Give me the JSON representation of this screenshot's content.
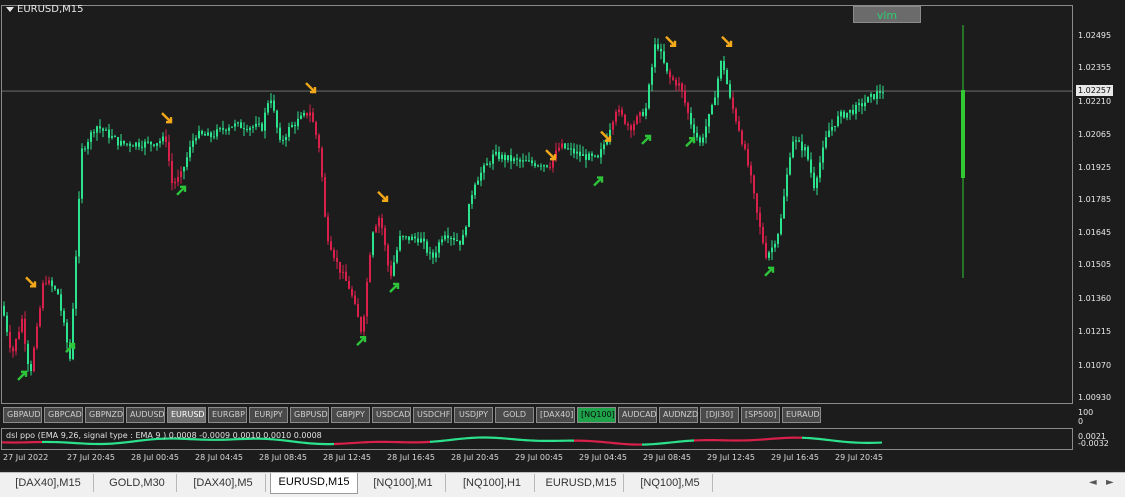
{
  "chart": {
    "title": "EURUSD,M15",
    "vlm_label": "vlm",
    "current_price": "1.02257",
    "price_labels": [
      "1.02495",
      "1.02355",
      "1.02210",
      "1.02065",
      "1.01925",
      "1.01785",
      "1.01645",
      "1.01505",
      "1.01360",
      "1.01215",
      "1.01070",
      "1.00930"
    ],
    "indicator_scale": [
      "100",
      "0"
    ],
    "indicator_values": [
      "0.0021",
      "-0.0032"
    ],
    "indicator_label": "dsl ppo (EMA 9,26, signal type : EMA 9 ) 0.0008 -0.0009 0.0010 0.0010 0.0008",
    "time_labels": [
      "27 Jul 2022",
      "27 Jul 20:45",
      "28 Jul 00:45",
      "28 Jul 04:45",
      "28 Jul 08:45",
      "28 Jul 12:45",
      "28 Jul 16:45",
      "28 Jul 20:45",
      "29 Jul 00:45",
      "29 Jul 04:45",
      "29 Jul 08:45",
      "29 Jul 12:45",
      "29 Jul 16:45",
      "29 Jul 20:45"
    ],
    "colors": {
      "bull": "#2de28c",
      "bear": "#d8204a",
      "up_arrow": "#2ec43a",
      "down_arrow": "#f2a818",
      "volume": "#32c832"
    }
  },
  "symbol_buttons": [
    "GBPAUD",
    "GBPCAD",
    "GBPNZD",
    "AUDUSD",
    "EURUSD",
    "EURGBP",
    "EURJPY",
    "GBPUSD",
    "GBPJPY",
    "USDCAD",
    "USDCHF",
    "USDJPY",
    "GOLD",
    "[DAX40]",
    "[NQ100]",
    "AUDCAD",
    "AUDNZD",
    "[DJI30]",
    "[SP500]",
    "EURAUD"
  ],
  "tabs": [
    "[DAX40],M15",
    "GOLD,M30",
    "[DAX40],M5",
    "EURUSD,M15",
    "[NQ100],M1",
    "[NQ100],H1",
    "EURUSD,M15",
    "[NQ100],M5"
  ],
  "active_tab": "EURUSD,M15",
  "scroll_left": "◄",
  "scroll_right": "►"
}
